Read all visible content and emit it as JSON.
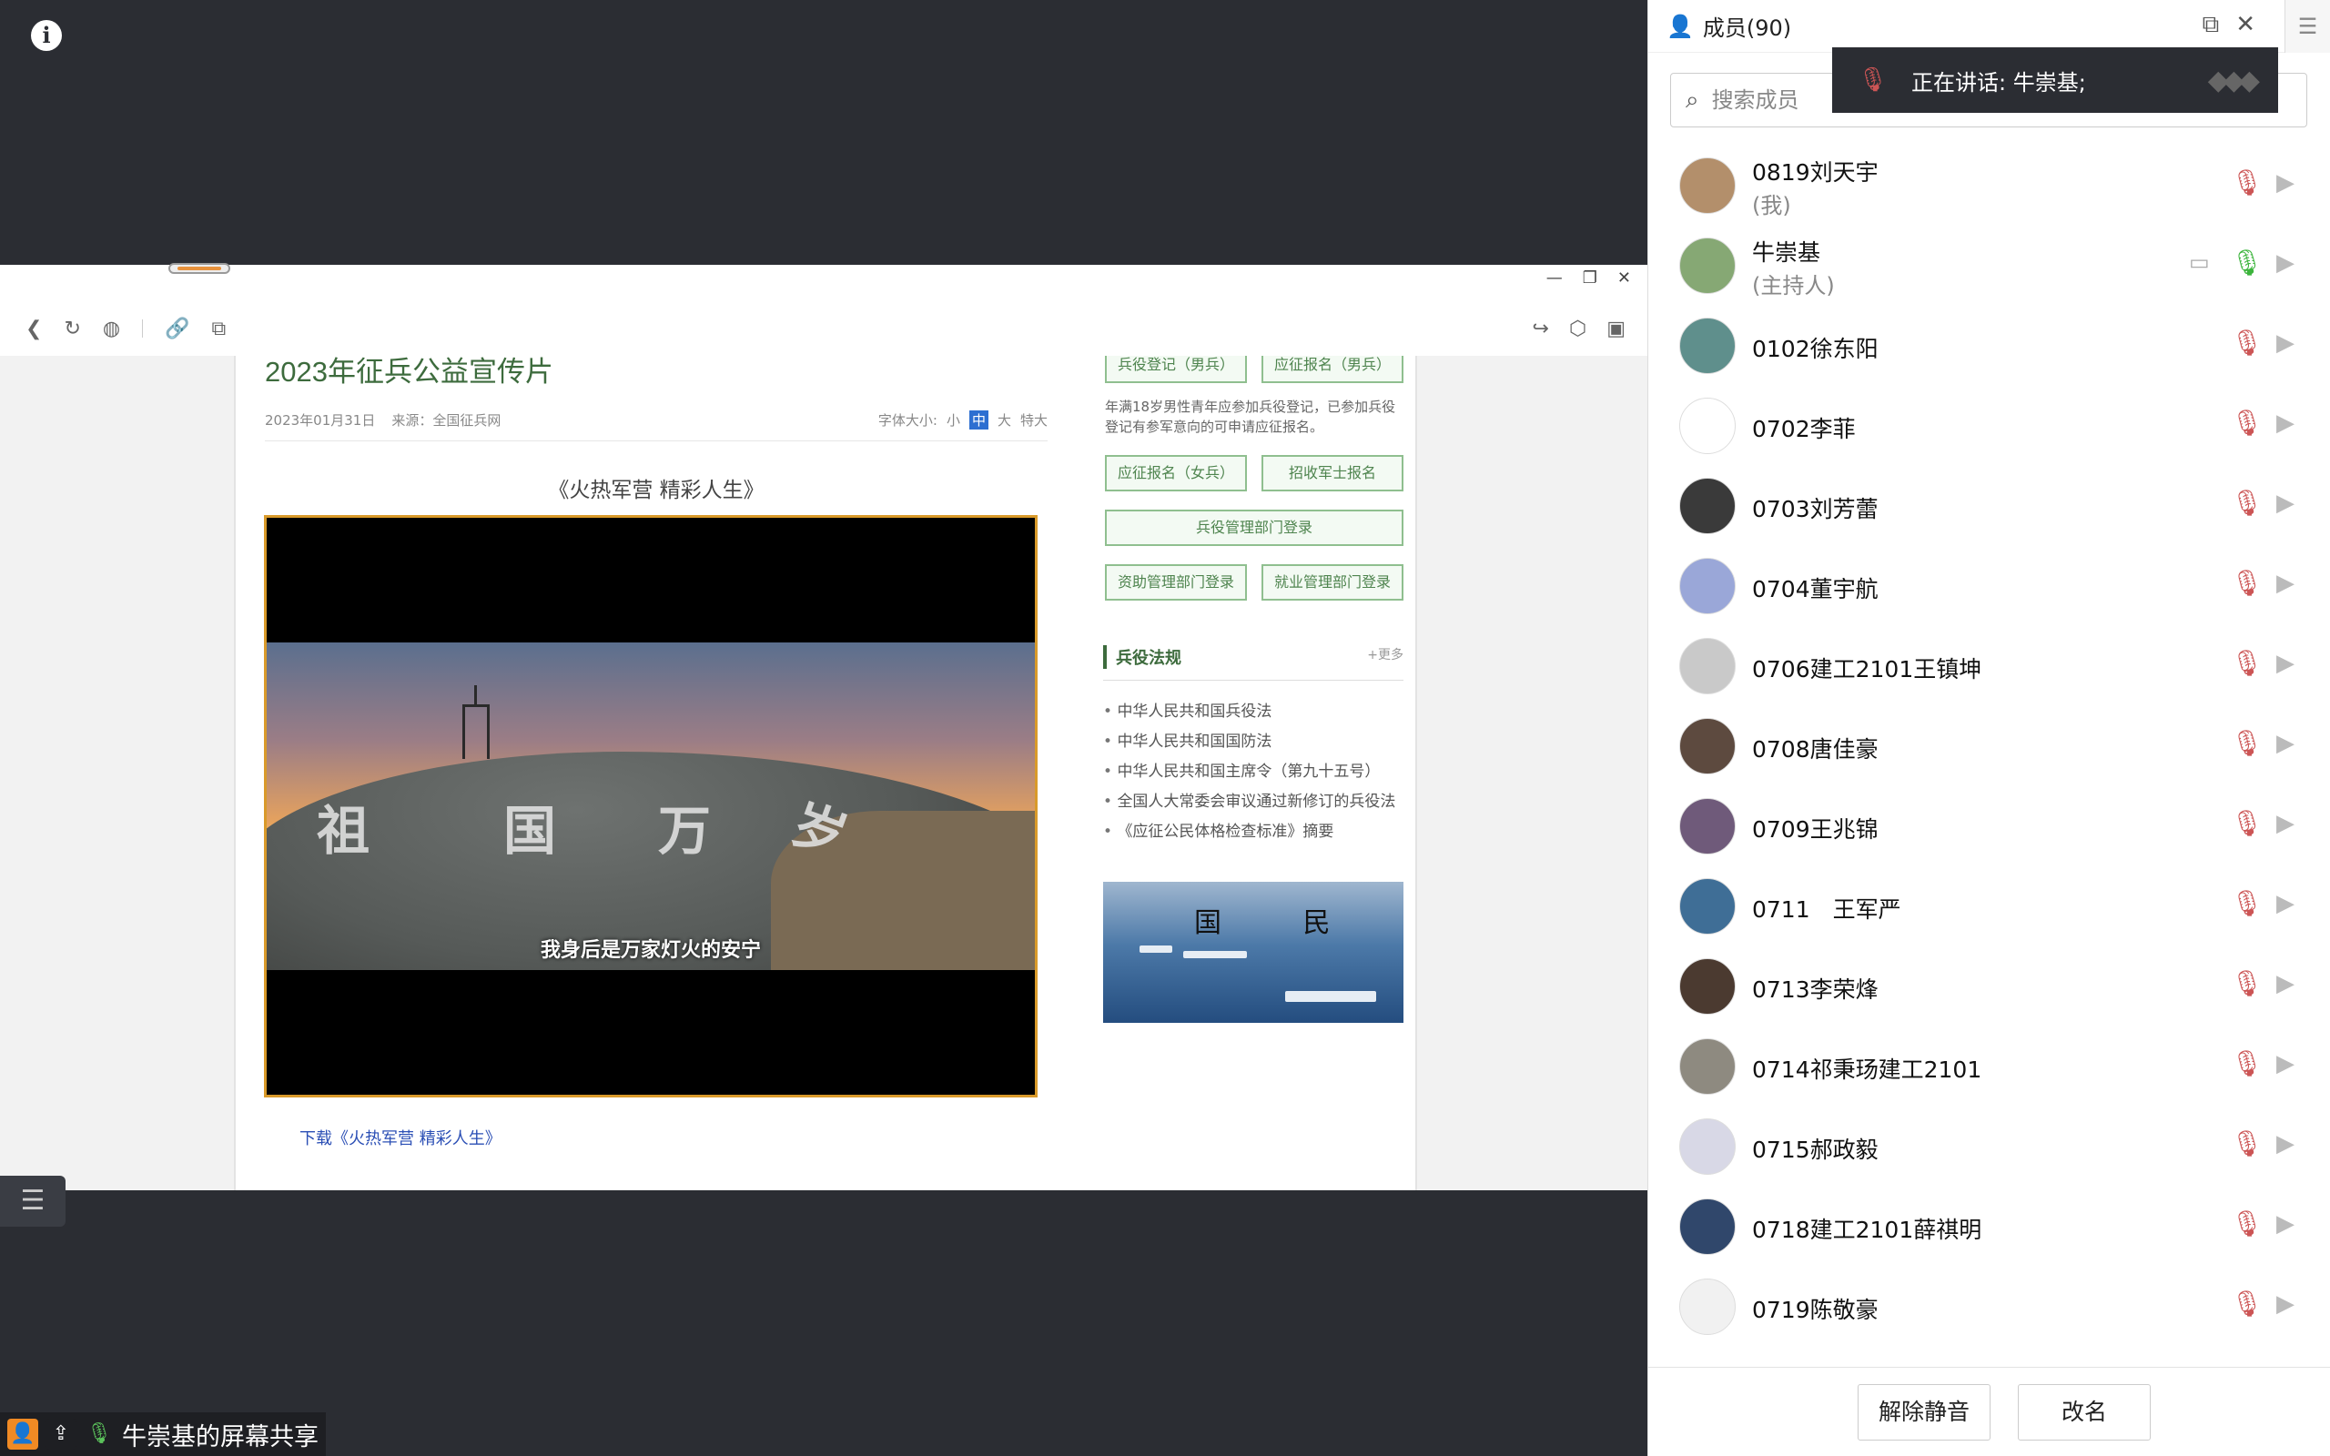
{
  "stage": {
    "share_label": "牛崇基的屏幕共享",
    "browser": {
      "article_title": "2023年征兵公益宣传片",
      "date": "2023年01月31日",
      "source": "来源：全国征兵网",
      "font_size_label": "字体大小:",
      "font_sizes": [
        "小",
        "中",
        "大",
        "特大"
      ],
      "video_caption": "《火热军营 精彩人生》",
      "video_subtitle": "我身后是万家灯火的安宁",
      "rock_text": [
        "祖",
        "国",
        "万",
        "岁"
      ],
      "download_link": "下载《火热军营 精彩人生》",
      "side_buttons": [
        "兵役登记（男兵）",
        "应征报名（男兵）",
        "应征报名（女兵）",
        "招收军士报名",
        "兵役管理部门登录",
        "资助管理部门登录",
        "就业管理部门登录"
      ],
      "side_note": "年满18岁男性青年应参加兵役登记，已参加兵役登记有参军意向的可申请应征报名。",
      "section_title": "兵役法规",
      "section_more": "+更多",
      "laws": [
        "中华人民共和国兵役法",
        "中华人民共和国国防法",
        "中华人民共和国主席令（第九十五号）",
        "全国人大常委会审议通过新修订的兵役法",
        "《应征公民体格检查标准》摘要"
      ],
      "banner_text": "国 民"
    }
  },
  "panel": {
    "title": "成员(90)",
    "search_placeholder": "搜索成员",
    "speaking": "正在讲话: 牛崇基;",
    "members": [
      {
        "name": "0819刘天宇",
        "role": "(我)",
        "avatar": "#b38f6b",
        "mic": "muted"
      },
      {
        "name": "牛崇基",
        "role": "(主持人)",
        "avatar": "#86a874",
        "mic": "on",
        "sharing": true
      },
      {
        "name": "0102徐东阳",
        "avatar": "#5f8f8c",
        "mic": "muted"
      },
      {
        "name": "0702李菲",
        "avatar": "#ffffff",
        "mic": "muted"
      },
      {
        "name": "0703刘芳蕾",
        "avatar": "#3a3a3a",
        "mic": "muted"
      },
      {
        "name": "0704董宇航",
        "avatar": "#9aa7d8",
        "mic": "muted"
      },
      {
        "name": "0706建工2101王镇坤",
        "avatar": "#c9c9c9",
        "mic": "muted"
      },
      {
        "name": "0708唐佳豪",
        "avatar": "#5d4a3f",
        "mic": "muted"
      },
      {
        "name": "0709王兆锦",
        "avatar": "#6f5a7a",
        "mic": "muted"
      },
      {
        "name": "0711　王军严",
        "avatar": "#3f6e96",
        "mic": "muted"
      },
      {
        "name": "0713李荣烽",
        "avatar": "#4b3a30",
        "mic": "muted"
      },
      {
        "name": "0714祁秉玚建工2101",
        "avatar": "#8e8a80",
        "mic": "muted"
      },
      {
        "name": "0715郝政毅",
        "avatar": "#d8d8e6",
        "mic": "muted"
      },
      {
        "name": "0718建工2101薛祺明",
        "avatar": "#30476b",
        "mic": "muted"
      },
      {
        "name": "0719陈敬豪",
        "avatar": "#f1f1f1",
        "mic": "muted"
      }
    ],
    "buttons": {
      "unmute": "解除静音",
      "rename": "改名"
    }
  }
}
